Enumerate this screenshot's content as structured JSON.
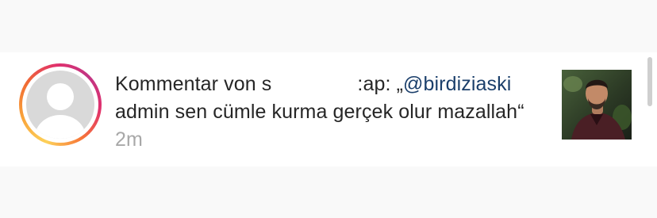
{
  "notification": {
    "prefix": "Kommentar von s",
    "suffix": ":ap: ",
    "comment_open": "„",
    "mention": "@birdiziaski",
    "comment_body": " admin sen cümle kurma gerçek olur mazallah“",
    "timestamp": "2m"
  },
  "colors": {
    "text": "#262626",
    "mention": "#1b3f6b",
    "timestamp": "#a8a8a8",
    "story_ring": [
      "#fdd15a",
      "#f77737",
      "#e1306c",
      "#c13584"
    ]
  },
  "icons": {
    "avatar": "default-profile-avatar-icon"
  }
}
